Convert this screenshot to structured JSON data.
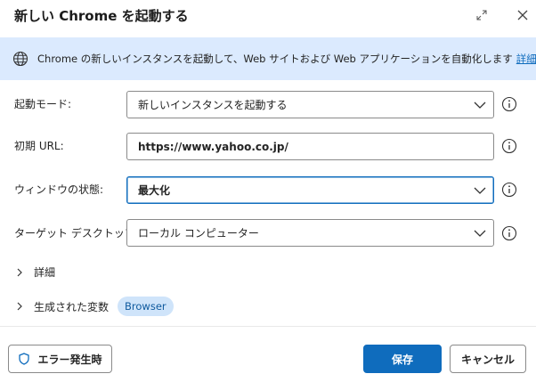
{
  "dialog": {
    "title": "新しい Chrome を起動する"
  },
  "info": {
    "text": "Chrome の新しいインスタンスを起動して、Web サイトおよび Web アプリケーションを自動化します",
    "link": "詳細"
  },
  "fields": {
    "launch_mode": {
      "label": "起動モード:",
      "value": "新しいインスタンスを起動する"
    },
    "initial_url": {
      "label": "初期 URL:",
      "value": "https://www.yahoo.co.jp/"
    },
    "window_state": {
      "label": "ウィンドウの状態:",
      "value": "最大化"
    },
    "target_desktop": {
      "label": "ターゲット デスクトップ:",
      "value": "ローカル コンピューター"
    }
  },
  "sections": {
    "details": "詳細",
    "generated_vars": "生成された変数",
    "variable_badge": "Browser"
  },
  "footer": {
    "error_button": "エラー発生時",
    "save_button": "保存",
    "cancel_button": "キャンセル"
  },
  "colors": {
    "accent": "#0f6cbd",
    "info_bg": "#dbeafe",
    "badge_bg": "#cfe4fa"
  }
}
